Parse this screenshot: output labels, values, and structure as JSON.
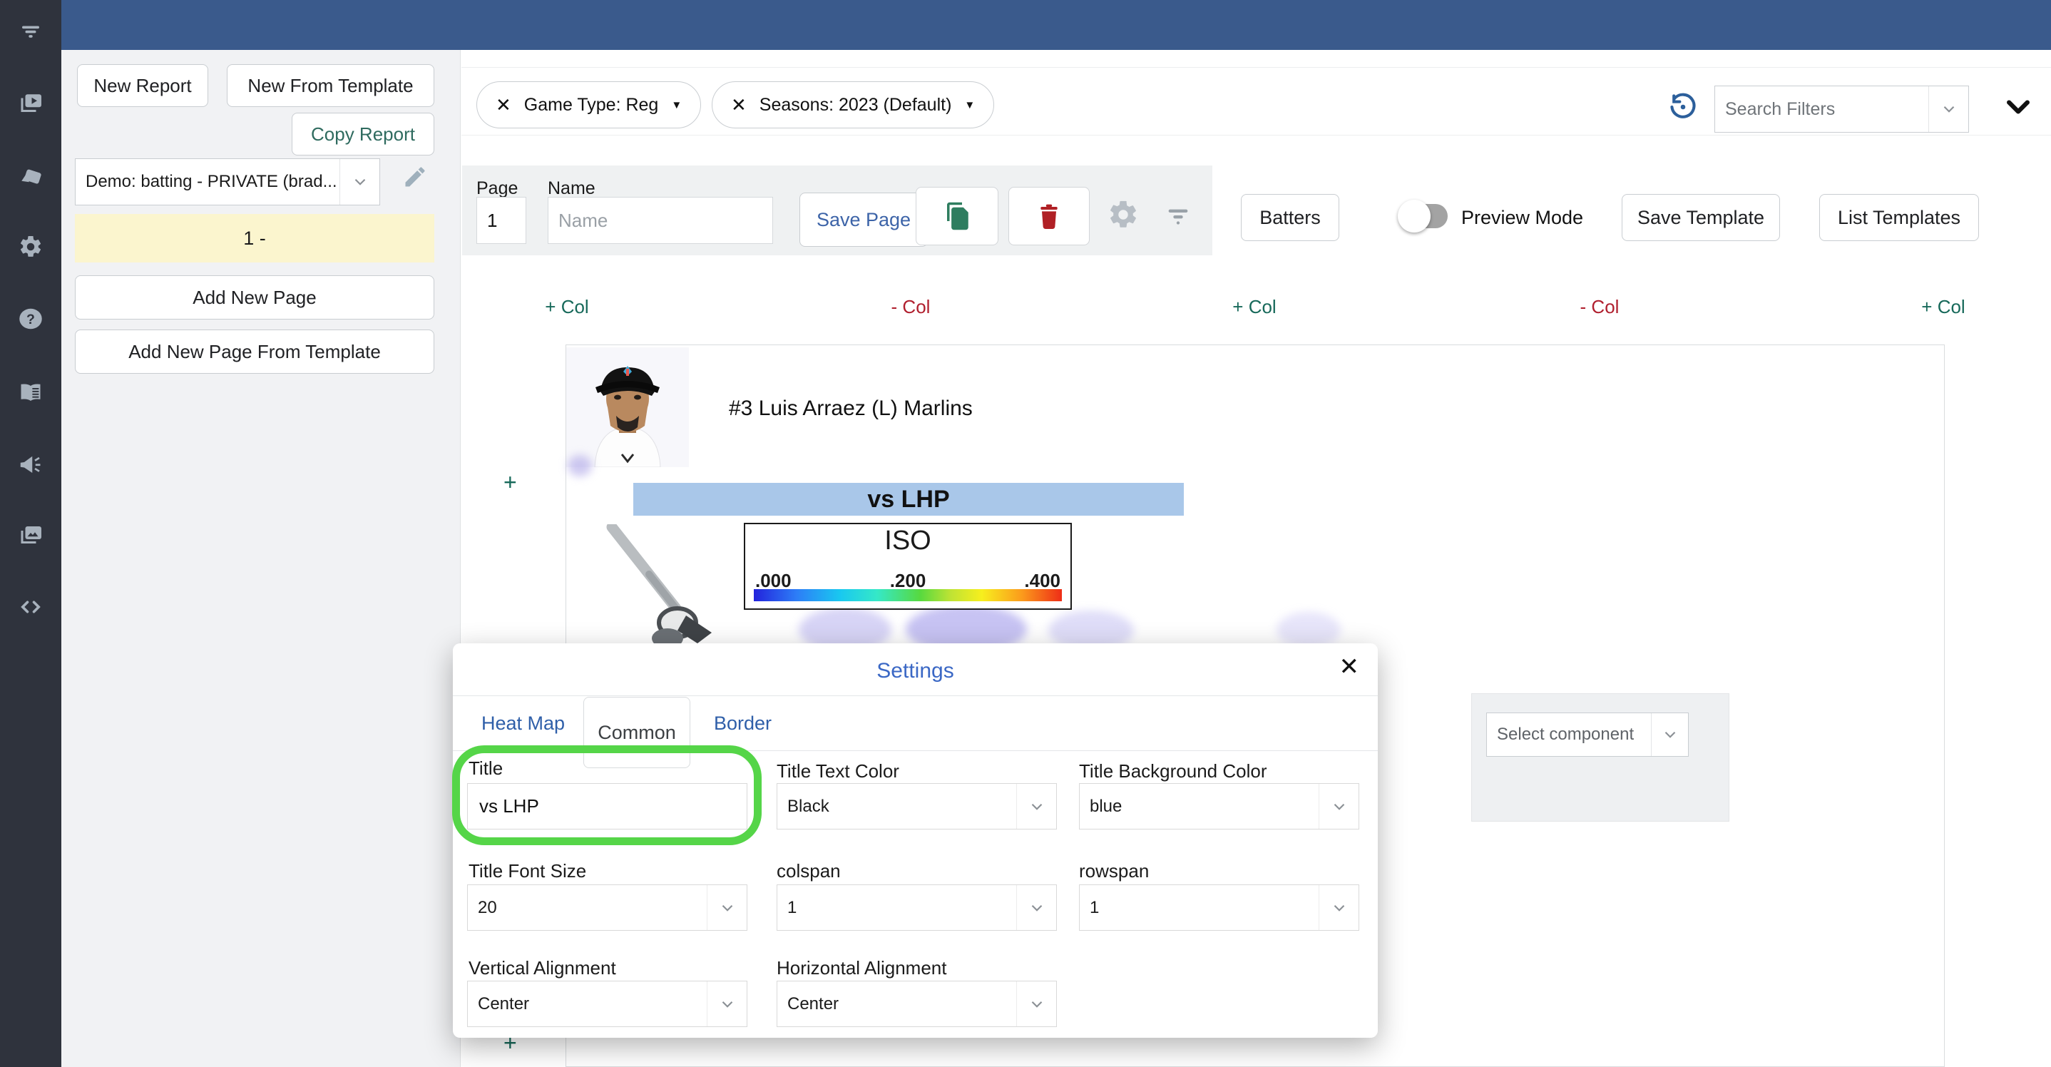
{
  "glyphs": {
    "close": "✕",
    "caret_down": "▼",
    "plus": "+"
  },
  "colors": {
    "topbar_blue": "#3A5A8C",
    "sidebar_dark": "#2F333D",
    "link_blue": "#2F5FA9",
    "settings_blue": "#3B68C5",
    "action_green": "#17695A",
    "action_red": "#B01F2E",
    "copy_icon_green": "#2E7D5F",
    "trash_icon_red": "#B02025",
    "banner_blue": "#A9C7E9",
    "highlight_green": "#55D548",
    "page_row_yellow": "#FBF5CE"
  },
  "sidebar": {
    "icons": [
      "menu-icon",
      "video-library-icon",
      "cards-icon",
      "gear-icon",
      "help-icon",
      "docs-icon",
      "announcements-icon",
      "image-gallery-icon",
      "code-icon"
    ]
  },
  "left_panel": {
    "new_report": "New Report",
    "new_from_template": "New From Template",
    "copy_report": "Copy Report",
    "report_select_value": "Demo: batting - PRIVATE (brad...",
    "page_row": "1 -",
    "add_new_page": "Add New Page",
    "add_new_page_from_template": "Add New Page From Template"
  },
  "filter_bar": {
    "chips": [
      {
        "label": "Game Type: Reg"
      },
      {
        "label": "Seasons: 2023 (Default)"
      }
    ],
    "search_placeholder": "Search Filters"
  },
  "toolbar": {
    "page_label": "Page",
    "page_value": "1",
    "name_label": "Name",
    "name_placeholder": "Name",
    "save_page": "Save Page",
    "batters": "Batters",
    "preview_mode": "Preview Mode",
    "save_template": "Save Template",
    "list_templates": "List Templates"
  },
  "grid_controls": {
    "items": [
      "+ Col",
      "- Col",
      "+ Col",
      "- Col",
      "+ Col"
    ],
    "add_row": "+"
  },
  "report": {
    "player": "#3 Luis Arraez (L) Marlins",
    "banner": "vs LHP",
    "legend": {
      "title": "ISO",
      "ticks": [
        ".000",
        ".200",
        ".400"
      ]
    },
    "select_component": "Select component"
  },
  "modal": {
    "title": "Settings",
    "tabs": [
      {
        "label": "Heat Map"
      },
      {
        "label": "Common"
      },
      {
        "label": "Border"
      }
    ],
    "fields": {
      "title_label": "Title",
      "title_value": "vs LHP",
      "text_color_label": "Title Text Color",
      "text_color_value": "Black",
      "bg_color_label": "Title Background Color",
      "bg_color_value": "blue",
      "font_size_label": "Title Font Size",
      "font_size_value": "20",
      "colspan_label": "colspan",
      "colspan_value": "1",
      "rowspan_label": "rowspan",
      "rowspan_value": "1",
      "valign_label": "Vertical Alignment",
      "valign_value": "Center",
      "halign_label": "Horizontal Alignment",
      "halign_value": "Center"
    }
  }
}
